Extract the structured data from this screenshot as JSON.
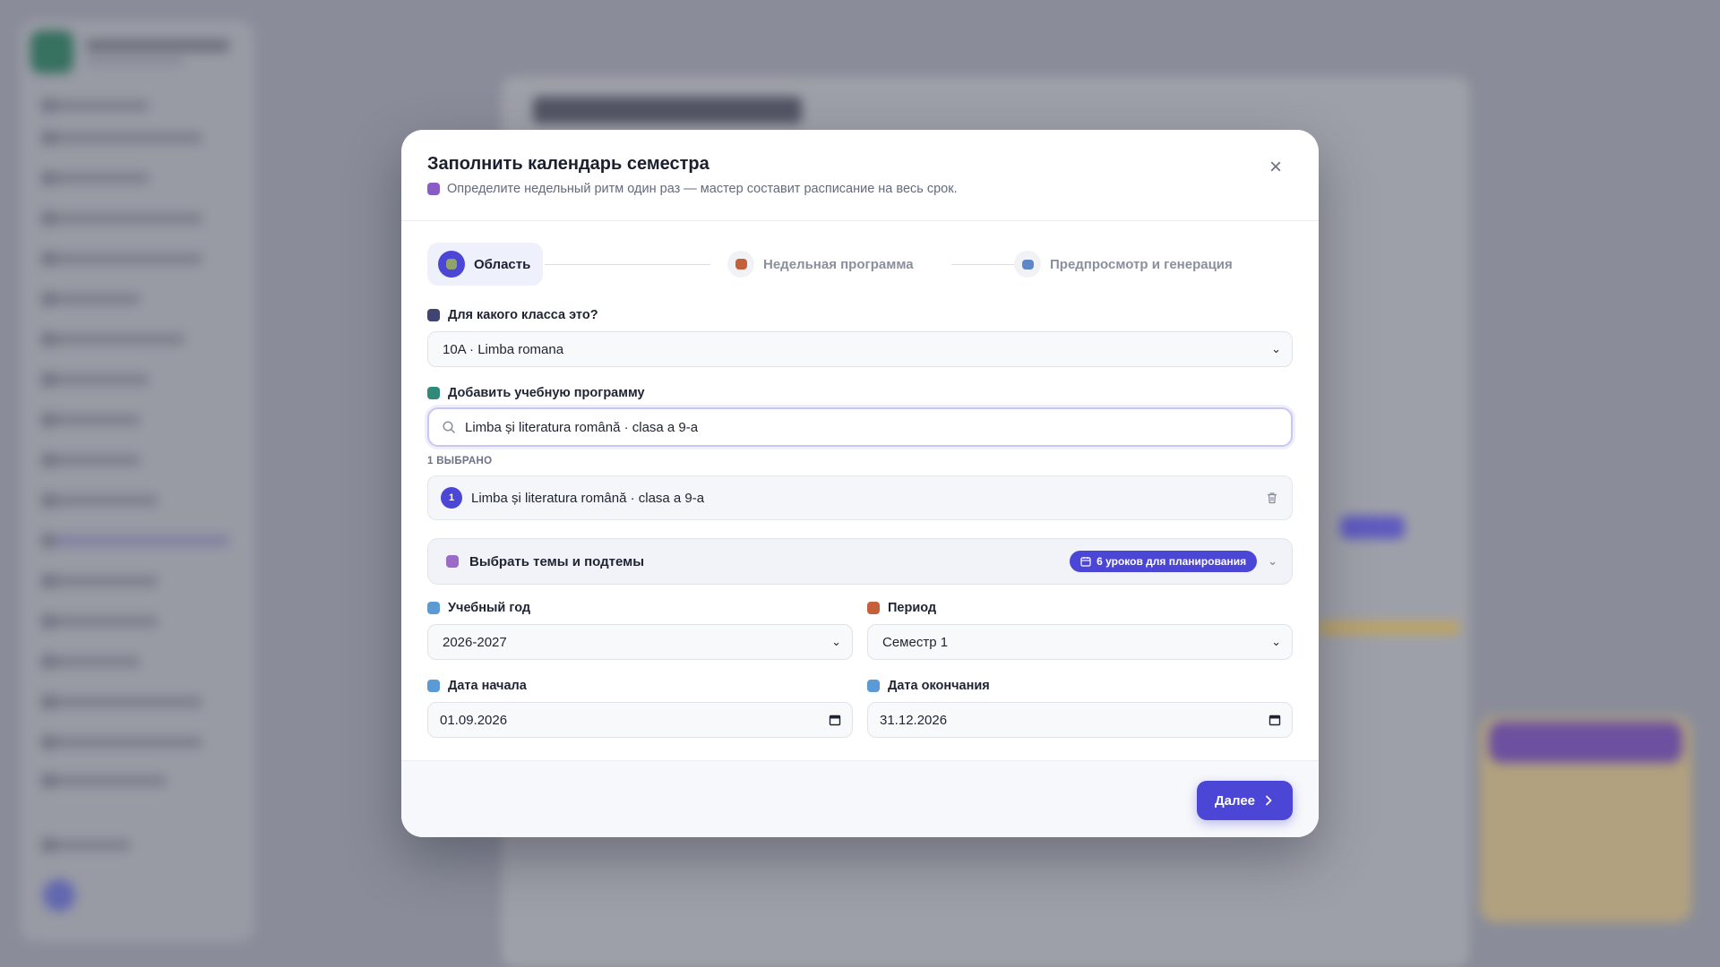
{
  "modal": {
    "title": "Заполнить календарь семестра",
    "subtitle": "Определите недельный ритм один раз — мастер составит расписание на весь срок.",
    "close_icon": "×"
  },
  "steps": [
    {
      "label": "Область",
      "icon": "books-icon",
      "state": "active"
    },
    {
      "label": "Недельная программа",
      "icon": "package-icon",
      "state": "idle"
    },
    {
      "label": "Предпросмотр и генерация",
      "icon": "preview-icon",
      "state": "idle"
    }
  ],
  "class_field": {
    "label": "Для какого класса это?",
    "value": "10A · Limba romana"
  },
  "program_field": {
    "label": "Добавить учебную программу",
    "search_value": "Limba și literatura română · clasa a 9-a",
    "selected_count_label": "1 ВЫБРАНО",
    "selected_items": [
      {
        "number": "1",
        "label": "Limba și literatura română · clasa a 9-a"
      }
    ]
  },
  "topics": {
    "label": "Выбрать темы и подтемы",
    "badge": "6 уроков для планирования"
  },
  "year_field": {
    "label": "Учебный год",
    "value": "2026-2027"
  },
  "period_field": {
    "label": "Период",
    "value": "Семестр 1"
  },
  "start_field": {
    "label": "Дата начала",
    "value": "01.09.2026"
  },
  "end_field": {
    "label": "Дата окончания",
    "value": "31.12.2026"
  },
  "footer": {
    "next_label": "Далее"
  },
  "colors": {
    "accent": "#4b46d6",
    "overlay": "#8a8d99",
    "modal_bg": "#ffffff"
  }
}
